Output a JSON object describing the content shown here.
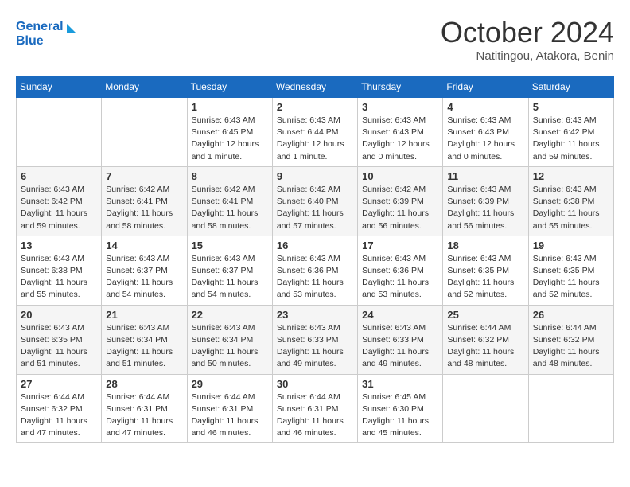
{
  "header": {
    "logo_line1": "General",
    "logo_line2": "Blue",
    "month_title": "October 2024",
    "subtitle": "Natitingou, Atakora, Benin"
  },
  "weekdays": [
    "Sunday",
    "Monday",
    "Tuesday",
    "Wednesday",
    "Thursday",
    "Friday",
    "Saturday"
  ],
  "weeks": [
    [
      {
        "day": "",
        "info": ""
      },
      {
        "day": "",
        "info": ""
      },
      {
        "day": "1",
        "info": "Sunrise: 6:43 AM\nSunset: 6:45 PM\nDaylight: 12 hours\nand 1 minute."
      },
      {
        "day": "2",
        "info": "Sunrise: 6:43 AM\nSunset: 6:44 PM\nDaylight: 12 hours\nand 1 minute."
      },
      {
        "day": "3",
        "info": "Sunrise: 6:43 AM\nSunset: 6:43 PM\nDaylight: 12 hours\nand 0 minutes."
      },
      {
        "day": "4",
        "info": "Sunrise: 6:43 AM\nSunset: 6:43 PM\nDaylight: 12 hours\nand 0 minutes."
      },
      {
        "day": "5",
        "info": "Sunrise: 6:43 AM\nSunset: 6:42 PM\nDaylight: 11 hours\nand 59 minutes."
      }
    ],
    [
      {
        "day": "6",
        "info": "Sunrise: 6:43 AM\nSunset: 6:42 PM\nDaylight: 11 hours\nand 59 minutes."
      },
      {
        "day": "7",
        "info": "Sunrise: 6:42 AM\nSunset: 6:41 PM\nDaylight: 11 hours\nand 58 minutes."
      },
      {
        "day": "8",
        "info": "Sunrise: 6:42 AM\nSunset: 6:41 PM\nDaylight: 11 hours\nand 58 minutes."
      },
      {
        "day": "9",
        "info": "Sunrise: 6:42 AM\nSunset: 6:40 PM\nDaylight: 11 hours\nand 57 minutes."
      },
      {
        "day": "10",
        "info": "Sunrise: 6:42 AM\nSunset: 6:39 PM\nDaylight: 11 hours\nand 56 minutes."
      },
      {
        "day": "11",
        "info": "Sunrise: 6:43 AM\nSunset: 6:39 PM\nDaylight: 11 hours\nand 56 minutes."
      },
      {
        "day": "12",
        "info": "Sunrise: 6:43 AM\nSunset: 6:38 PM\nDaylight: 11 hours\nand 55 minutes."
      }
    ],
    [
      {
        "day": "13",
        "info": "Sunrise: 6:43 AM\nSunset: 6:38 PM\nDaylight: 11 hours\nand 55 minutes."
      },
      {
        "day": "14",
        "info": "Sunrise: 6:43 AM\nSunset: 6:37 PM\nDaylight: 11 hours\nand 54 minutes."
      },
      {
        "day": "15",
        "info": "Sunrise: 6:43 AM\nSunset: 6:37 PM\nDaylight: 11 hours\nand 54 minutes."
      },
      {
        "day": "16",
        "info": "Sunrise: 6:43 AM\nSunset: 6:36 PM\nDaylight: 11 hours\nand 53 minutes."
      },
      {
        "day": "17",
        "info": "Sunrise: 6:43 AM\nSunset: 6:36 PM\nDaylight: 11 hours\nand 53 minutes."
      },
      {
        "day": "18",
        "info": "Sunrise: 6:43 AM\nSunset: 6:35 PM\nDaylight: 11 hours\nand 52 minutes."
      },
      {
        "day": "19",
        "info": "Sunrise: 6:43 AM\nSunset: 6:35 PM\nDaylight: 11 hours\nand 52 minutes."
      }
    ],
    [
      {
        "day": "20",
        "info": "Sunrise: 6:43 AM\nSunset: 6:35 PM\nDaylight: 11 hours\nand 51 minutes."
      },
      {
        "day": "21",
        "info": "Sunrise: 6:43 AM\nSunset: 6:34 PM\nDaylight: 11 hours\nand 51 minutes."
      },
      {
        "day": "22",
        "info": "Sunrise: 6:43 AM\nSunset: 6:34 PM\nDaylight: 11 hours\nand 50 minutes."
      },
      {
        "day": "23",
        "info": "Sunrise: 6:43 AM\nSunset: 6:33 PM\nDaylight: 11 hours\nand 49 minutes."
      },
      {
        "day": "24",
        "info": "Sunrise: 6:43 AM\nSunset: 6:33 PM\nDaylight: 11 hours\nand 49 minutes."
      },
      {
        "day": "25",
        "info": "Sunrise: 6:44 AM\nSunset: 6:32 PM\nDaylight: 11 hours\nand 48 minutes."
      },
      {
        "day": "26",
        "info": "Sunrise: 6:44 AM\nSunset: 6:32 PM\nDaylight: 11 hours\nand 48 minutes."
      }
    ],
    [
      {
        "day": "27",
        "info": "Sunrise: 6:44 AM\nSunset: 6:32 PM\nDaylight: 11 hours\nand 47 minutes."
      },
      {
        "day": "28",
        "info": "Sunrise: 6:44 AM\nSunset: 6:31 PM\nDaylight: 11 hours\nand 47 minutes."
      },
      {
        "day": "29",
        "info": "Sunrise: 6:44 AM\nSunset: 6:31 PM\nDaylight: 11 hours\nand 46 minutes."
      },
      {
        "day": "30",
        "info": "Sunrise: 6:44 AM\nSunset: 6:31 PM\nDaylight: 11 hours\nand 46 minutes."
      },
      {
        "day": "31",
        "info": "Sunrise: 6:45 AM\nSunset: 6:30 PM\nDaylight: 11 hours\nand 45 minutes."
      },
      {
        "day": "",
        "info": ""
      },
      {
        "day": "",
        "info": ""
      }
    ]
  ]
}
